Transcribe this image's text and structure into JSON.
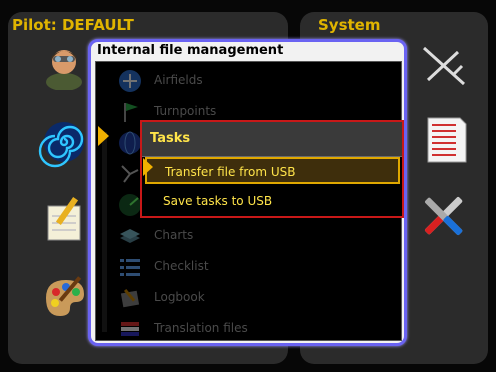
{
  "left_panel": {
    "title": "Pilot: DEFAULT",
    "items": [
      {
        "icon": "pilot-icon"
      },
      {
        "icon": "spiral-icon"
      },
      {
        "icon": "notepad-icon"
      },
      {
        "icon": "palette-icon"
      }
    ]
  },
  "right_panel": {
    "title": "System",
    "items": [
      {
        "icon": "airplane-icon"
      },
      {
        "icon": "document-list-icon"
      },
      {
        "icon": "tools-icon"
      }
    ]
  },
  "dialog": {
    "title": "Internal file management",
    "items": [
      {
        "label": "Airfields",
        "icon": "airfield-icon"
      },
      {
        "label": "Turnpoints",
        "icon": "flag-icon"
      },
      {
        "label": "",
        "icon": "globe-icon"
      },
      {
        "label": "",
        "icon": "wind-icon"
      },
      {
        "label": "",
        "icon": "radar-icon"
      },
      {
        "label": "Charts",
        "icon": "chart-layers-icon"
      },
      {
        "label": "Checklist",
        "icon": "checklist-icon"
      },
      {
        "label": "Logbook",
        "icon": "logbook-icon"
      },
      {
        "label": "Translation files",
        "icon": "translation-icon"
      }
    ]
  },
  "popup": {
    "title": "Tasks",
    "items": [
      {
        "label": "Transfer file from USB",
        "selected": true
      },
      {
        "label": "Save tasks to USB",
        "selected": false
      }
    ]
  },
  "colors": {
    "accent_title": "#e0b400",
    "popup_text": "#ffe44a",
    "popup_border": "#c81818",
    "dialog_border": "#6a63f2",
    "selection_border": "#e0a800"
  }
}
